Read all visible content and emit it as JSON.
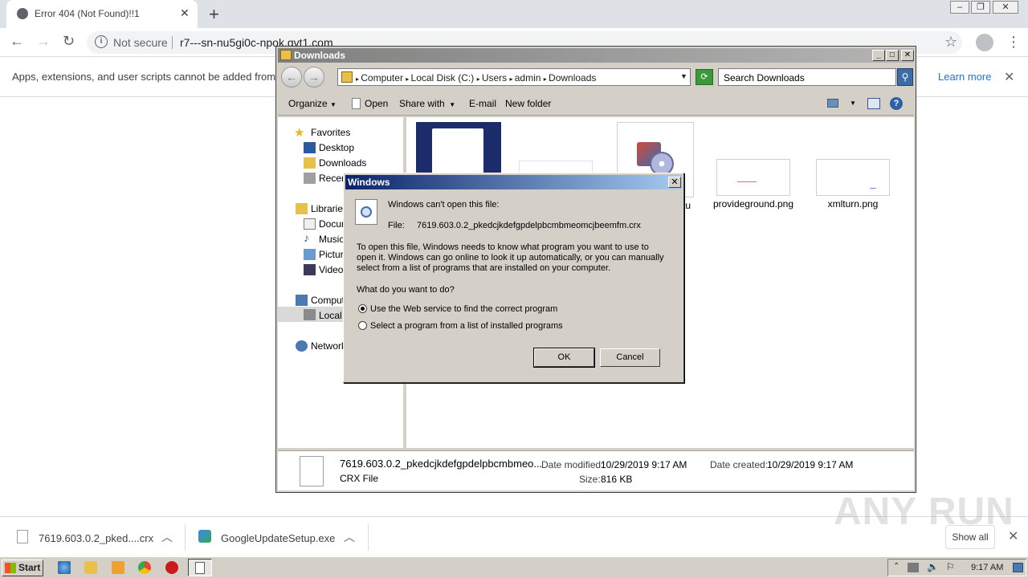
{
  "browser": {
    "tab_title": "Error 404 (Not Found)!!1",
    "tab_close": "✕",
    "new_tab": "+",
    "not_secure": "Not secure",
    "url": "r7---sn-nu5gi0c-npok.gvt1.com",
    "infobar_message": "Apps, extensions, and user scripts cannot be added from th",
    "learn_more": "Learn more",
    "infobar_close": "✕"
  },
  "explorer": {
    "title": "Downloads",
    "breadcrumb": [
      "Computer",
      "Local Disk (C:)",
      "Users",
      "admin",
      "Downloads"
    ],
    "search_placeholder": "Search Downloads",
    "commands": {
      "organize": "Organize",
      "open": "Open",
      "share_with": "Share with",
      "email": "E-mail",
      "new_folder": "New folder"
    },
    "nav": {
      "favorites": "Favorites",
      "desktop": "Desktop",
      "downloads": "Downloads",
      "recent": "Recen",
      "libraries": "Libraries",
      "documents": "Docum",
      "music": "Music",
      "pictures": "Picture",
      "videos": "Videos",
      "computer": "Compute",
      "local_disk": "Local D",
      "network": "Network"
    },
    "files": [
      {
        "name": "tu"
      },
      {
        "name": "provideground.png"
      },
      {
        "name": "xmlturn.png"
      }
    ],
    "details": {
      "name": "7619.603.0.2_pkedcjkdefgpdelpbcmbmeo...",
      "type": "CRX File",
      "modified_label": "Date modified:",
      "modified": "10/29/2019 9:17 AM",
      "size_label": "Size:",
      "size": "816 KB",
      "created_label": "Date created:",
      "created": "10/29/2019 9:17 AM"
    }
  },
  "dialog": {
    "title": "Windows",
    "heading": "Windows can't open this file:",
    "file_label": "File:",
    "file_name": "7619.603.0.2_pkedcjkdefgpdelpbcmbmeomcjbeemfm.crx",
    "explain_1": "To open this file, Windows needs to know what program you want to use to",
    "explain_2": "open it. Windows can go online to look it up automatically, or you can manually",
    "explain_3": "select from a list of programs that are installed on your computer.",
    "question": "What do you want to do?",
    "option_web": "Use the Web service to find the correct program",
    "option_list": "Select a program from a list of installed programs",
    "selected_option": "option_web",
    "ok": "OK",
    "cancel": "Cancel"
  },
  "downloads_shelf": {
    "items": [
      {
        "name": "7619.603.0.2_pked....crx"
      },
      {
        "name": "GoogleUpdateSetup.exe"
      }
    ],
    "show_all": "Show all"
  },
  "watermark": "ANY RUN",
  "taskbar": {
    "start": "Start",
    "clock": "9:17 AM"
  }
}
